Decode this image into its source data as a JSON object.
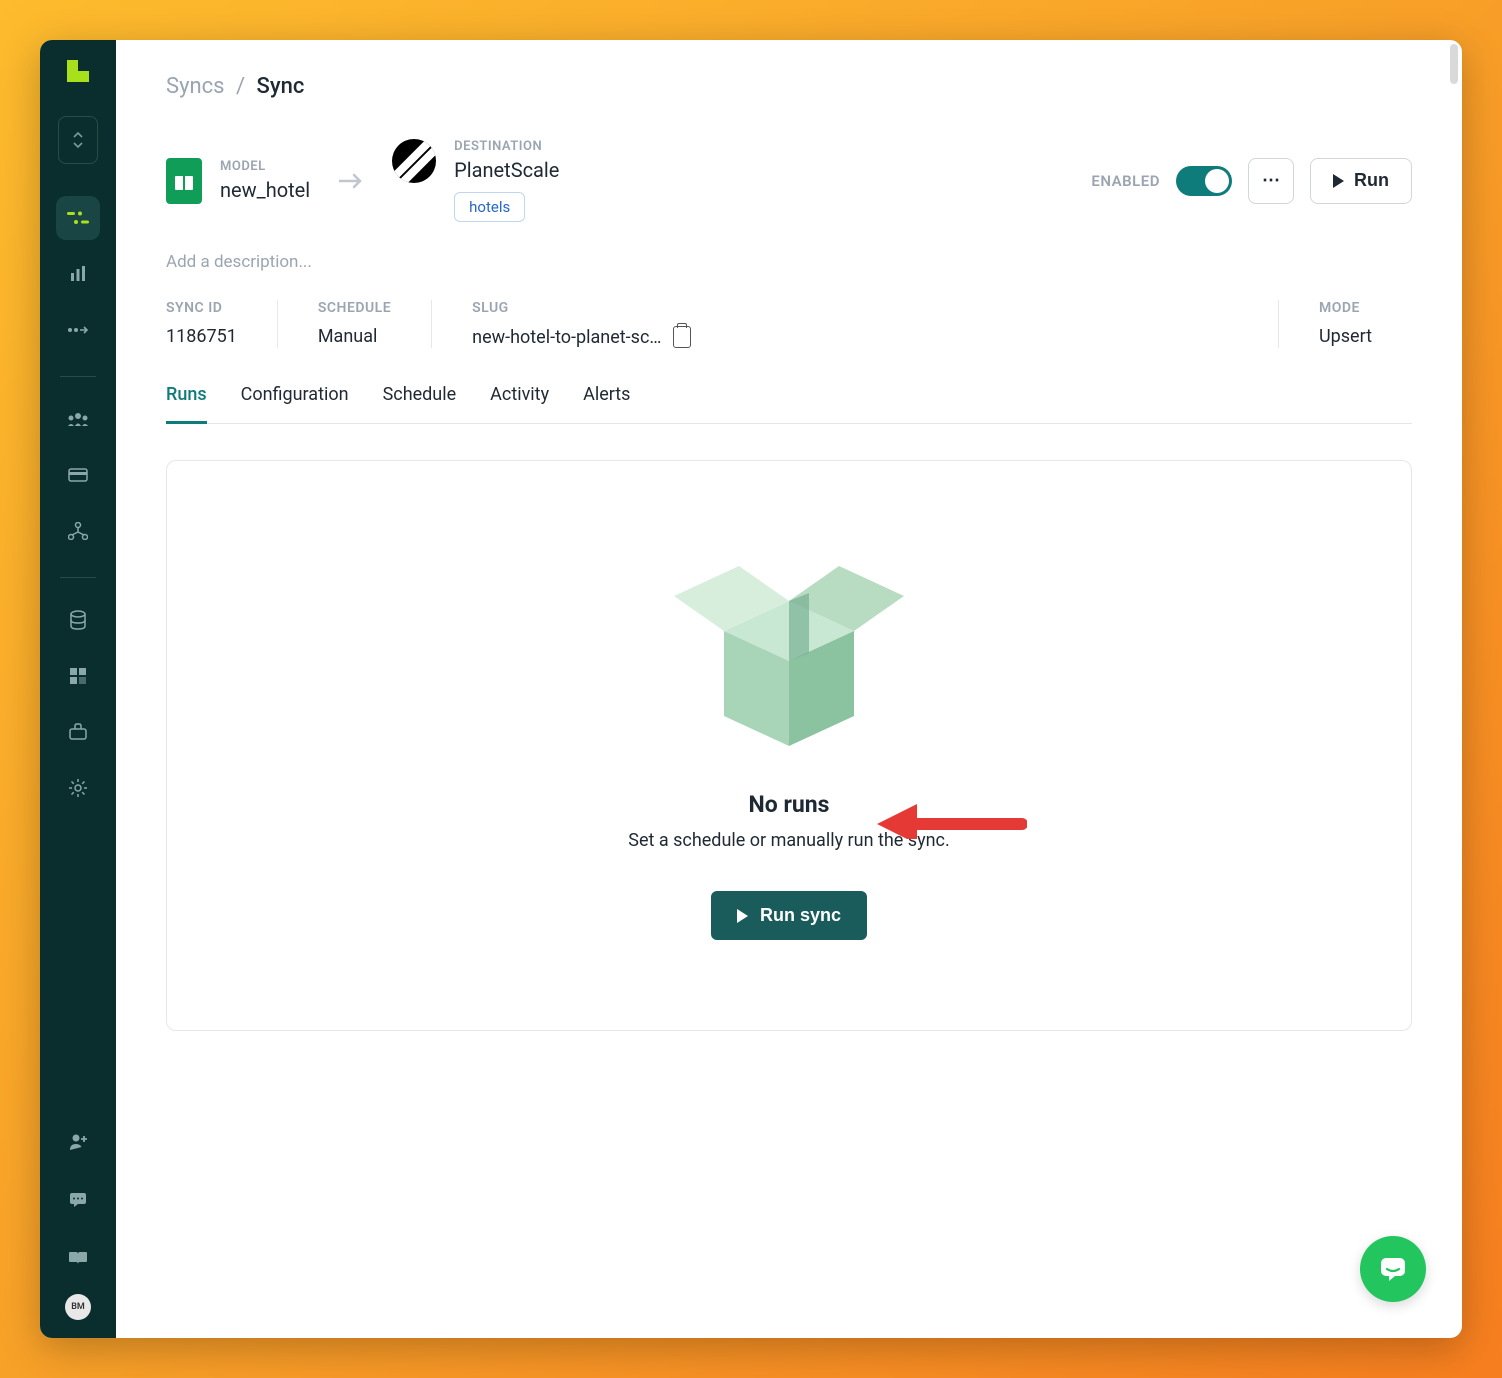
{
  "breadcrumb": {
    "parent": "Syncs",
    "current": "Sync"
  },
  "model": {
    "label": "MODEL",
    "name": "new_hotel"
  },
  "destination": {
    "label": "DESTINATION",
    "name": "PlanetScale",
    "tag": "hotels"
  },
  "enabled": {
    "label": "ENABLED",
    "on": true
  },
  "actions": {
    "run": "Run"
  },
  "description_placeholder": "Add a description...",
  "meta": {
    "sync_id": {
      "label": "SYNC ID",
      "value": "1186751"
    },
    "schedule": {
      "label": "SCHEDULE",
      "value": "Manual"
    },
    "slug": {
      "label": "SLUG",
      "value": "new-hotel-to-planet-sc…"
    },
    "mode": {
      "label": "MODE",
      "value": "Upsert"
    }
  },
  "tabs": [
    "Runs",
    "Configuration",
    "Schedule",
    "Activity",
    "Alerts"
  ],
  "active_tab": "Runs",
  "empty": {
    "title": "No runs",
    "subtitle": "Set a schedule or manually run the sync.",
    "button": "Run sync"
  },
  "avatar": "BM"
}
